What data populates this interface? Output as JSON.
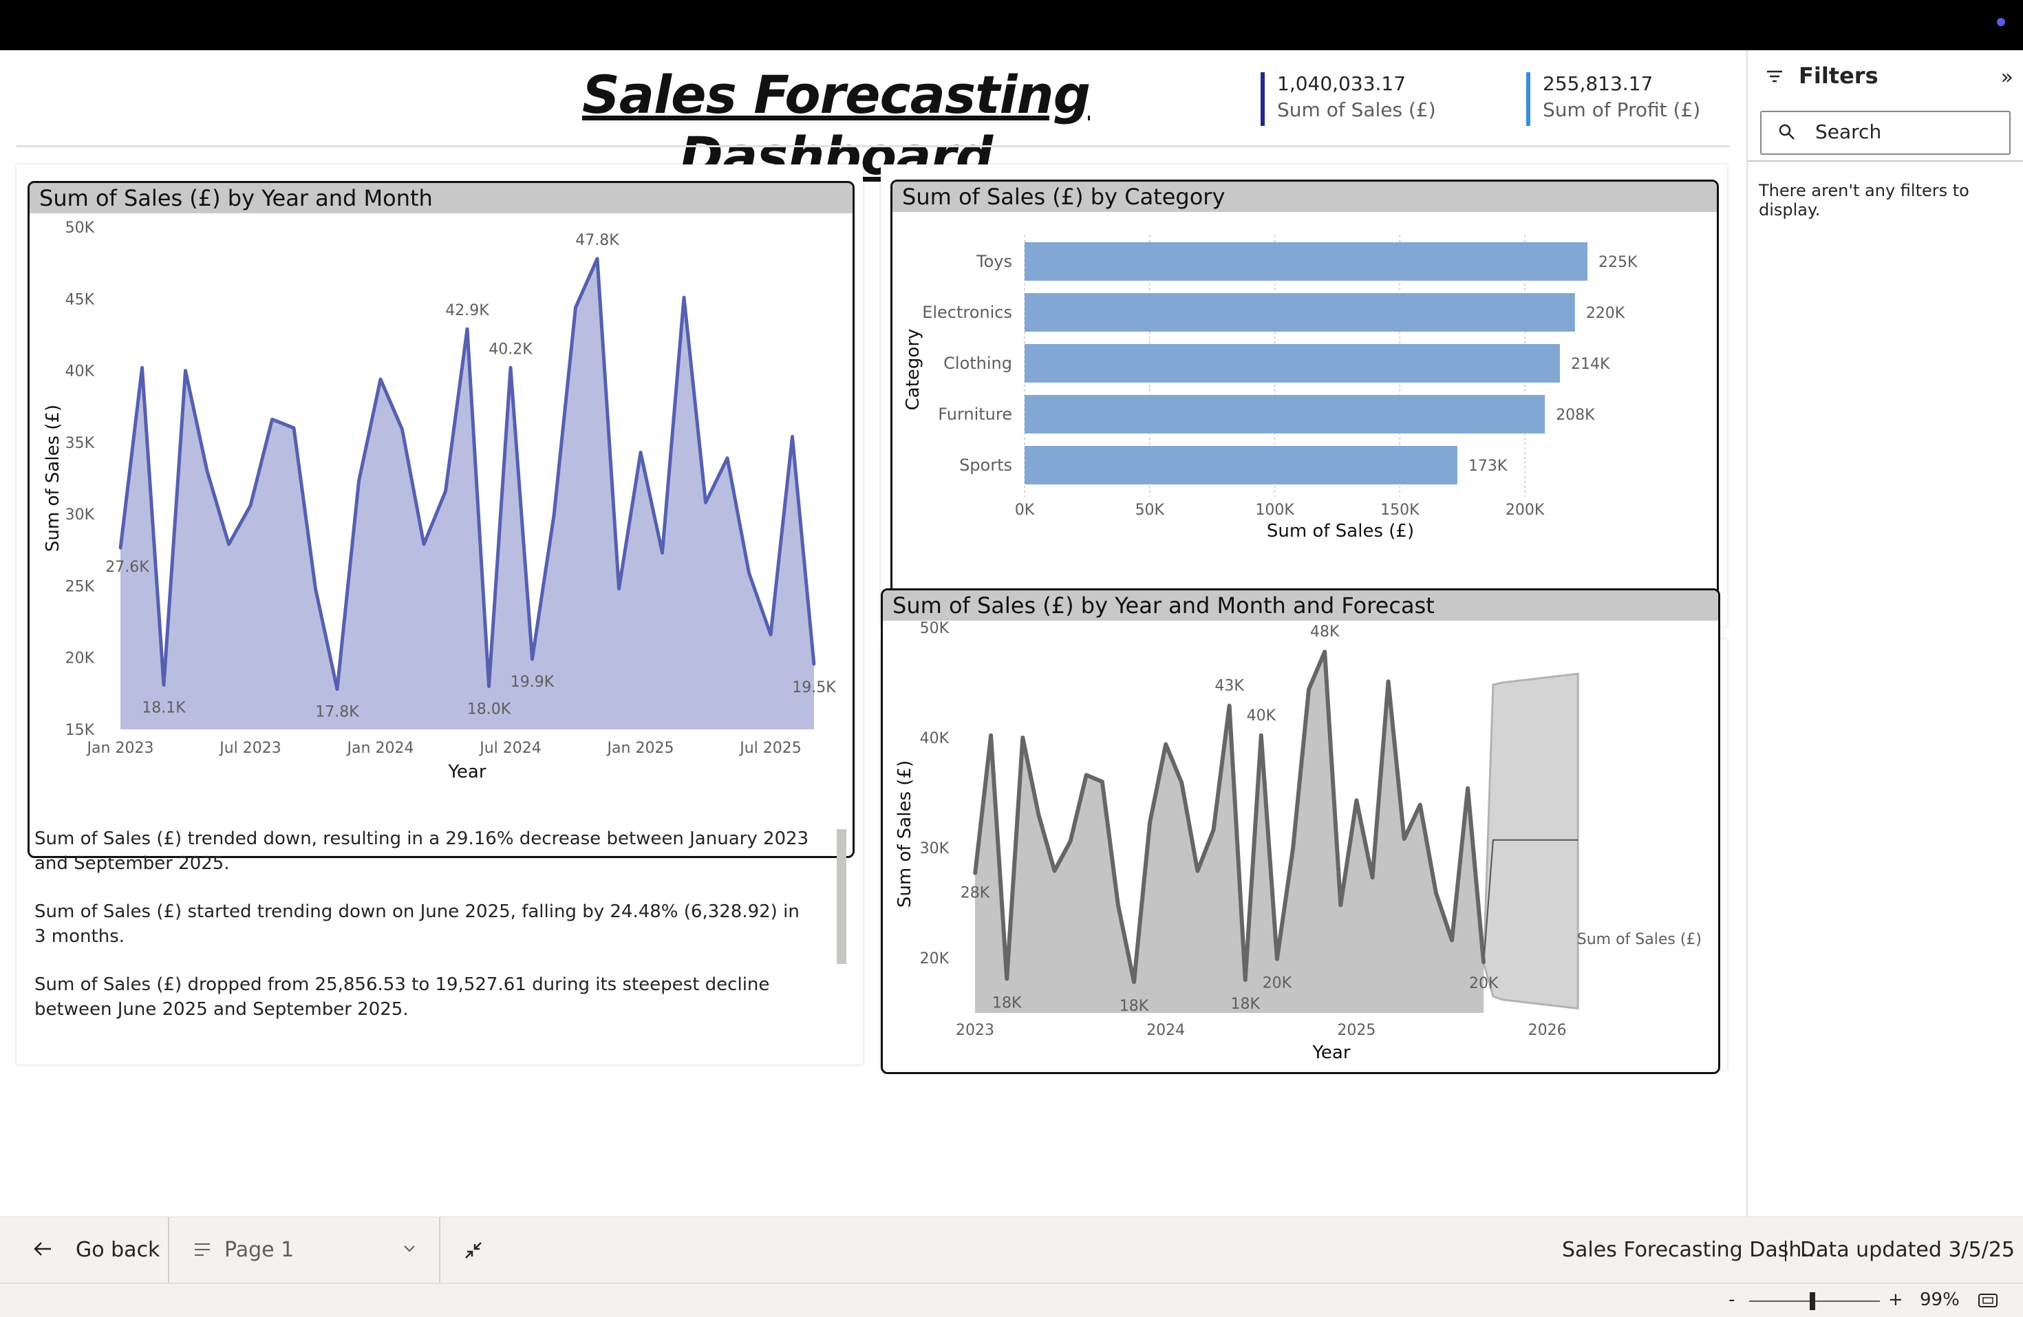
{
  "header": {
    "title": "Sales Forecasting Dashboard",
    "kpis": [
      {
        "value": "1,040,033.17",
        "label": "Sum of Sales (£)",
        "color": "#1f2a8c"
      },
      {
        "value": "255,813.17",
        "label": "Sum of Profit (£)",
        "color": "#3a8de0"
      }
    ]
  },
  "charts": {
    "line": {
      "title": "Sum of Sales (£) by Year and Month"
    },
    "bar": {
      "title": "Sum of Sales (£) by Category"
    },
    "forecast": {
      "title": "Sum of Sales (£) by Year and Month and Forecast"
    }
  },
  "narrative": {
    "paragraphs": [
      "Sum of Sales (£) trended down, resulting in a 29.16% decrease between January 2023 and September 2025.",
      "Sum of Sales (£) started trending down on June 2025, falling by 24.48% (6,328.92) in 3 months.",
      "Sum of Sales (£) dropped from 25,856.53 to 19,527.61 during its steepest decline between June 2025 and September 2025."
    ]
  },
  "filters": {
    "title": "Filters",
    "collapse_glyph": "»",
    "search_placeholder": "Search",
    "empty_message": "There aren't any filters to display."
  },
  "footer": {
    "back_label": "Go back",
    "page_label": "Page 1",
    "report_name": "Sales Forecasting Dash...",
    "data_updated": "Data updated 3/5/25"
  },
  "statusbar": {
    "zoom": "99%",
    "minus": "-",
    "plus": "+"
  },
  "chart_data": [
    {
      "type": "area",
      "title": "Sum of Sales (£) by Year and Month",
      "xlabel": "Year",
      "ylabel": "Sum of Sales (£)",
      "ylim": [
        15000,
        50000
      ],
      "yticks": [
        "15K",
        "20K",
        "25K",
        "30K",
        "35K",
        "40K",
        "45K",
        "50K"
      ],
      "xticks": [
        "Jan 2023",
        "Jul 2023",
        "Jan 2024",
        "Jul 2024",
        "Jan 2025",
        "Jul 2025"
      ],
      "color": "#5560b0",
      "fill": "#b9bde0",
      "x": [
        "2023-01",
        "2023-02",
        "2023-03",
        "2023-04",
        "2023-05",
        "2023-06",
        "2023-07",
        "2023-08",
        "2023-09",
        "2023-10",
        "2023-11",
        "2023-12",
        "2024-01",
        "2024-02",
        "2024-03",
        "2024-04",
        "2024-05",
        "2024-06",
        "2024-07",
        "2024-08",
        "2024-09",
        "2024-10",
        "2024-11",
        "2024-12",
        "2025-01",
        "2025-02",
        "2025-03",
        "2025-04",
        "2025-05",
        "2025-06",
        "2025-07",
        "2025-08",
        "2025-09"
      ],
      "values": [
        27600,
        40200,
        18100,
        40000,
        33000,
        27900,
        30600,
        36600,
        36000,
        24800,
        17800,
        32300,
        39400,
        35900,
        27900,
        31600,
        42900,
        18000,
        40200,
        19900,
        29900,
        44400,
        47800,
        24800,
        34300,
        27300,
        45100,
        30800,
        33900,
        25900,
        21600,
        35400,
        19500
      ],
      "data_labels": [
        {
          "i": 0,
          "text": "27.6K"
        },
        {
          "i": 2,
          "text": "18.1K"
        },
        {
          "i": 10,
          "text": "17.8K"
        },
        {
          "i": 16,
          "text": "42.9K"
        },
        {
          "i": 17,
          "text": "18.0K"
        },
        {
          "i": 18,
          "text": "40.2K"
        },
        {
          "i": 19,
          "text": "19.9K"
        },
        {
          "i": 22,
          "text": "47.8K"
        },
        {
          "i": 32,
          "text": "19.5K"
        }
      ]
    },
    {
      "type": "bar",
      "orientation": "horizontal",
      "title": "Sum of Sales (£) by Category",
      "xlabel": "Sum of Sales (£)",
      "ylabel": "Category",
      "categories": [
        "Toys",
        "Electronics",
        "Clothing",
        "Furniture",
        "Sports"
      ],
      "values": [
        225000,
        220000,
        214000,
        208000,
        173000
      ],
      "data_labels": [
        "225K",
        "220K",
        "214K",
        "208K",
        "173K"
      ],
      "xlim": [
        0,
        225000
      ],
      "xticks": [
        "0K",
        "50K",
        "100K",
        "150K",
        "200K"
      ],
      "color": "#83a7d4"
    },
    {
      "type": "area",
      "title": "Sum of Sales (£) by Year and Month and Forecast",
      "xlabel": "Year",
      "ylabel": "Sum of Sales (£)",
      "ylim": [
        15000,
        50000
      ],
      "yticks": [
        "20K",
        "30K",
        "40K",
        "50K"
      ],
      "xticks": [
        "2023",
        "2024",
        "2025",
        "2026"
      ],
      "legend": "Sum of Sales (£)",
      "color": "#666666",
      "fill": "#c4c4c4",
      "values": [
        27600,
        40200,
        18100,
        40000,
        33000,
        27900,
        30600,
        36600,
        36000,
        24800,
        17800,
        32300,
        39400,
        35900,
        27900,
        31600,
        42900,
        18000,
        40200,
        19900,
        29900,
        44400,
        47800,
        24800,
        34300,
        27300,
        45100,
        30800,
        33900,
        25900,
        21600,
        35400,
        19500
      ],
      "forecast": {
        "months": 10,
        "value": 30700,
        "upper": [
          44800,
          45000,
          45100,
          45200,
          45300,
          45400,
          45500,
          45600,
          45700,
          45800
        ],
        "lower": [
          16500,
          16200,
          16100,
          16000,
          15900,
          15800,
          15700,
          15600,
          15500,
          15400
        ]
      },
      "data_labels": [
        {
          "i": 0,
          "text": "28K"
        },
        {
          "i": 2,
          "text": "18K"
        },
        {
          "i": 10,
          "text": "18K"
        },
        {
          "i": 16,
          "text": "43K"
        },
        {
          "i": 17,
          "text": "18K"
        },
        {
          "i": 18,
          "text": "40K"
        },
        {
          "i": 19,
          "text": "20K"
        },
        {
          "i": 22,
          "text": "48K"
        },
        {
          "i": 32,
          "text": "20K"
        }
      ]
    }
  ]
}
